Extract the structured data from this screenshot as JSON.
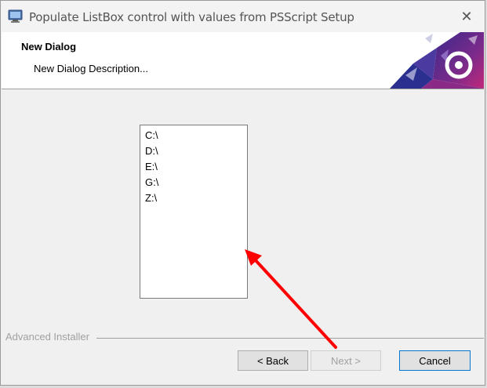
{
  "window": {
    "title": "Populate ListBox control with values from PSScript Setup",
    "close_glyph": "✕"
  },
  "header": {
    "title": "New Dialog",
    "description": "New Dialog Description..."
  },
  "listbox": {
    "items": [
      "C:\\",
      "D:\\",
      "E:\\",
      "G:\\",
      "Z:\\"
    ]
  },
  "footer": {
    "brand": "Advanced Installer"
  },
  "buttons": {
    "back": "< Back",
    "next": "Next >",
    "cancel": "Cancel"
  },
  "colors": {
    "arrow": "#ff0000",
    "cancel_border": "#0078d4"
  }
}
